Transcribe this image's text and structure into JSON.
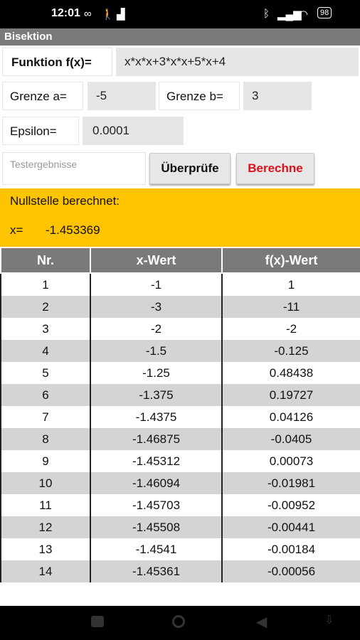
{
  "status": {
    "time": "12:01",
    "icons": [
      "infinity-icon",
      "walk-icon",
      "chart-icon",
      "bluetooth-icon",
      "signal-icon",
      "wifi-icon",
      "battery-icon"
    ],
    "battery": "98"
  },
  "app": {
    "title": "Bisektion",
    "function_label": "Funktion f(x)=",
    "function_value": "x*x*x+3*x*x+5*x+4",
    "a_label": "Grenze a=",
    "a_value": "-5",
    "b_label": "Grenze b=",
    "b_value": "3",
    "epsilon_label": "Epsilon=",
    "epsilon_value": "0.0001",
    "test_placeholder": "Testergebnisse",
    "check_button": "Überprüfe",
    "calc_button": "Berechne",
    "calc_color": "#e0101a"
  },
  "result": {
    "heading": "Nullstelle berechnet:",
    "x_label": "x=",
    "x_value": "-1.453369",
    "bg_color": "#ffc400"
  },
  "table": {
    "headers": [
      "Nr.",
      "x-Wert",
      "f(x)-Wert"
    ],
    "rows": [
      [
        "1",
        "-1",
        "1"
      ],
      [
        "2",
        "-3",
        "-11"
      ],
      [
        "3",
        "-2",
        "-2"
      ],
      [
        "4",
        "-1.5",
        "-0.125"
      ],
      [
        "5",
        "-1.25",
        "0.48438"
      ],
      [
        "6",
        "-1.375",
        "0.19727"
      ],
      [
        "7",
        "-1.4375",
        "0.04126"
      ],
      [
        "8",
        "-1.46875",
        "-0.0405"
      ],
      [
        "9",
        "-1.45312",
        "0.00073"
      ],
      [
        "10",
        "-1.46094",
        "-0.01981"
      ],
      [
        "11",
        "-1.45703",
        "-0.00952"
      ],
      [
        "12",
        "-1.45508",
        "-0.00441"
      ],
      [
        "13",
        "-1.4541",
        "-0.00184"
      ],
      [
        "14",
        "-1.45361",
        "-0.00056"
      ]
    ]
  },
  "nav": {
    "icons": [
      "square-icon",
      "home-circle-icon",
      "back-triangle-icon",
      "keyboard-down-icon"
    ]
  }
}
